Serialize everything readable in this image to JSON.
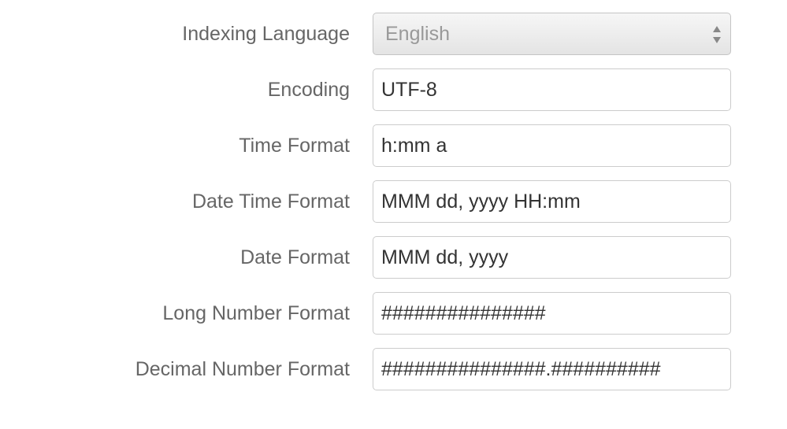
{
  "form": {
    "indexing_language": {
      "label": "Indexing Language",
      "value": "English"
    },
    "encoding": {
      "label": "Encoding",
      "value": "UTF-8"
    },
    "time_format": {
      "label": "Time Format",
      "value": "h:mm a"
    },
    "date_time_format": {
      "label": "Date Time Format",
      "value": "MMM dd, yyyy HH:mm"
    },
    "date_format": {
      "label": "Date Format",
      "value": "MMM dd, yyyy"
    },
    "long_number_format": {
      "label": "Long Number Format",
      "value": "###############"
    },
    "decimal_number_format": {
      "label": "Decimal Number Format",
      "value": "###############.##########"
    }
  },
  "icons": {
    "select_arrows": "chevron-up-down-icon"
  },
  "colors": {
    "label_text": "#666666",
    "input_text": "#333333",
    "disabled_text": "#999999",
    "border": "#cccccc"
  }
}
